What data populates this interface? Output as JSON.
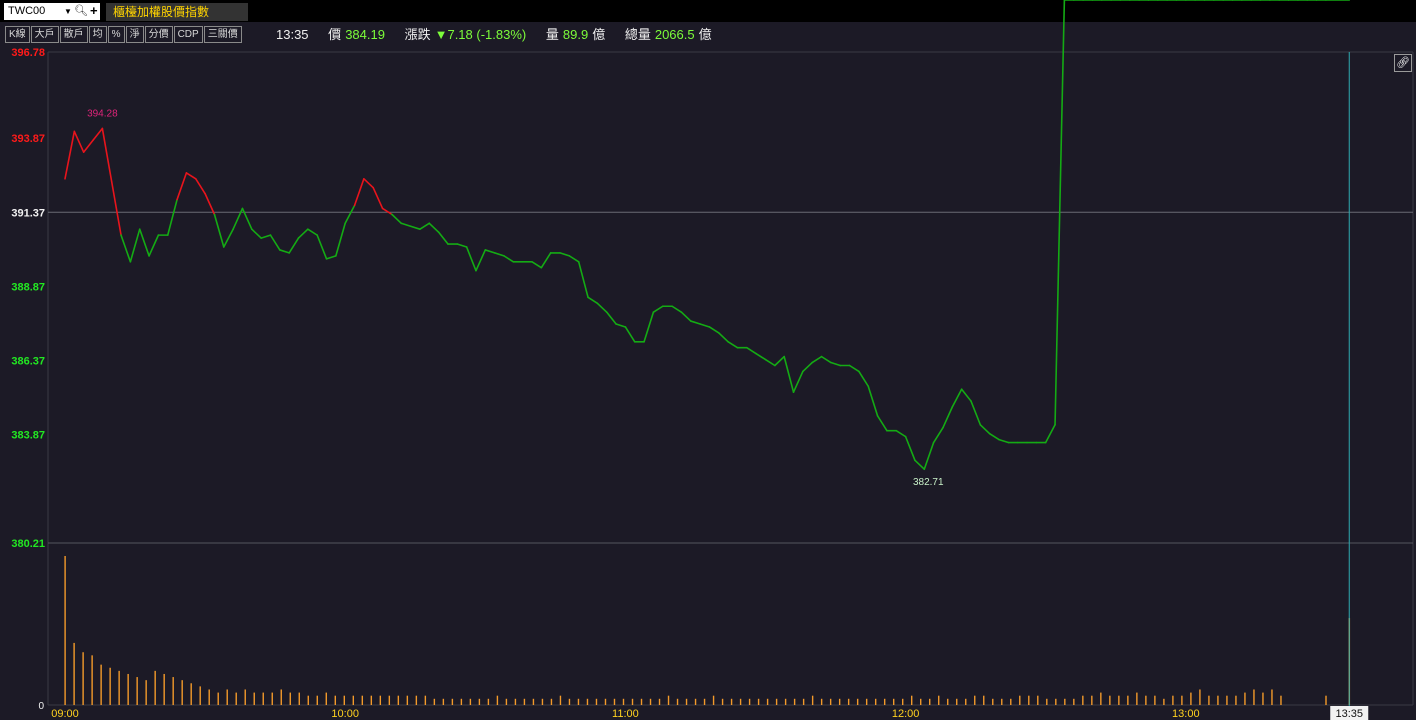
{
  "symbol": {
    "code": "TWC00",
    "title": "櫃檯加權股價指數"
  },
  "toolbar": [
    "K線",
    "大戶",
    "散戶",
    "均",
    "%",
    "淨",
    "分價",
    "CDP",
    "三關價"
  ],
  "quote": {
    "time": "13:35",
    "price_label": "價",
    "price": "384.19",
    "change_label": "漲跌",
    "change": "▼7.18 (-1.83%)",
    "volume_label": "量",
    "volume": "89.9",
    "total_label": "總量",
    "total": "2066.5",
    "unit": "億"
  },
  "colors": {
    "up": "#e8141c",
    "down": "#14ab14",
    "volume": "#f39a2a",
    "cursor": "#2eaab0"
  },
  "chart_data": {
    "type": "line",
    "reference_price": 391.37,
    "ylim": [
      380.21,
      396.78
    ],
    "y_ticks": [
      "396.78",
      "393.87",
      "391.37",
      "388.87",
      "386.37",
      "383.87",
      "380.21"
    ],
    "x_ticks": [
      "09:00",
      "10:00",
      "11:00",
      "12:00",
      "13:00"
    ],
    "cursor_label": "13:35",
    "high_label": "394.28",
    "low_label": "382.71",
    "volume_zero_label": "0",
    "x": [
      "09:00",
      "09:02",
      "09:04",
      "09:06",
      "09:08",
      "09:10",
      "09:12",
      "09:14",
      "09:16",
      "09:18",
      "09:20",
      "09:22",
      "09:24",
      "09:26",
      "09:28",
      "09:30",
      "09:32",
      "09:34",
      "09:36",
      "09:38",
      "09:40",
      "09:42",
      "09:44",
      "09:46",
      "09:48",
      "09:50",
      "09:52",
      "09:54",
      "09:56",
      "09:58",
      "10:00",
      "10:02",
      "10:04",
      "10:06",
      "10:08",
      "10:10",
      "10:12",
      "10:14",
      "10:16",
      "10:18",
      "10:20",
      "10:22",
      "10:24",
      "10:26",
      "10:28",
      "10:30",
      "10:32",
      "10:34",
      "10:36",
      "10:38",
      "10:40",
      "10:42",
      "10:44",
      "10:46",
      "10:48",
      "10:50",
      "10:52",
      "10:54",
      "10:56",
      "10:58",
      "11:00",
      "11:02",
      "11:04",
      "11:06",
      "11:08",
      "11:10",
      "11:12",
      "11:14",
      "11:16",
      "11:18",
      "11:20",
      "11:22",
      "11:24",
      "11:26",
      "11:28",
      "11:30",
      "11:32",
      "11:34",
      "11:36",
      "11:38",
      "11:40",
      "11:42",
      "11:44",
      "11:46",
      "11:48",
      "11:50",
      "11:52",
      "11:54",
      "11:56",
      "11:58",
      "12:00",
      "12:02",
      "12:04",
      "12:06",
      "12:08",
      "12:10",
      "12:12",
      "12:14",
      "12:16",
      "12:18",
      "12:20",
      "12:22",
      "12:24",
      "12:26",
      "12:28",
      "12:30",
      "12:32",
      "12:34",
      "12:36",
      "12:38",
      "12:40",
      "12:42",
      "12:44",
      "12:46",
      "12:48",
      "12:50",
      "12:52",
      "12:54",
      "12:56",
      "12:58",
      "13:00",
      "13:02",
      "13:04",
      "13:06",
      "13:08",
      "13:10",
      "13:12",
      "13:14",
      "13:16",
      "13:18",
      "13:20",
      "13:22",
      "13:24",
      "13:26",
      "13:28",
      "13:30",
      "13:35"
    ],
    "price": [
      392.5,
      394.1,
      393.4,
      393.8,
      394.2,
      392.4,
      390.6,
      389.7,
      390.8,
      389.9,
      390.6,
      390.6,
      391.8,
      392.7,
      392.5,
      392.0,
      391.3,
      390.2,
      390.8,
      391.5,
      390.8,
      390.5,
      390.6,
      390.1,
      390.0,
      390.5,
      390.8,
      390.6,
      389.8,
      389.9,
      391.0,
      391.6,
      392.5,
      392.2,
      391.5,
      391.3,
      391.0,
      390.9,
      390.8,
      391.0,
      390.7,
      390.3,
      390.3,
      390.2,
      389.4,
      390.1,
      390.0,
      389.9,
      389.7,
      389.7,
      389.7,
      389.5,
      390.0,
      390.0,
      389.9,
      389.7,
      388.5,
      388.3,
      388.0,
      387.6,
      387.5,
      387.0,
      387.0,
      388.0,
      388.2,
      388.2,
      388.0,
      387.7,
      387.6,
      387.5,
      387.3,
      387.0,
      386.8,
      386.8,
      386.6,
      386.4,
      386.2,
      386.5,
      385.3,
      386.0,
      386.3,
      386.5,
      386.3,
      386.2,
      386.2,
      386.0,
      385.5,
      384.5,
      384.0,
      384.0,
      383.8,
      383.0,
      382.7,
      383.6,
      384.1,
      384.8,
      385.4,
      385.0,
      384.2,
      383.9,
      383.7,
      383.6,
      383.6,
      383.6,
      383.6,
      383.6,
      384.2
    ],
    "volume": [
      48,
      20,
      17,
      16,
      13,
      12,
      11,
      10,
      9,
      8,
      11,
      10,
      9,
      8,
      7,
      6,
      5,
      4,
      5,
      4,
      5,
      4,
      4,
      4,
      5,
      4,
      4,
      3,
      3,
      4,
      3,
      3,
      3,
      3,
      3,
      3,
      3,
      3,
      3,
      3,
      3,
      2,
      2,
      2,
      2,
      2,
      2,
      2,
      3,
      2,
      2,
      2,
      2,
      2,
      2,
      3,
      2,
      2,
      2,
      2,
      2,
      2,
      2,
      2,
      2,
      2,
      2,
      3,
      2,
      2,
      2,
      2,
      3,
      2,
      2,
      2,
      2,
      2,
      2,
      2,
      2,
      2,
      2,
      3,
      2,
      2,
      2,
      2,
      2,
      2,
      2,
      2,
      2,
      2,
      3,
      2,
      2,
      3,
      2,
      2,
      2,
      3,
      3,
      2,
      2,
      2,
      3,
      3,
      3,
      2,
      2,
      2,
      2,
      3,
      3,
      4,
      3,
      3,
      3,
      4,
      3,
      3,
      2,
      3,
      3,
      4,
      5,
      3,
      3,
      3,
      3,
      4,
      5,
      4,
      5,
      3,
      0,
      0,
      0,
      0,
      3,
      28
    ]
  }
}
